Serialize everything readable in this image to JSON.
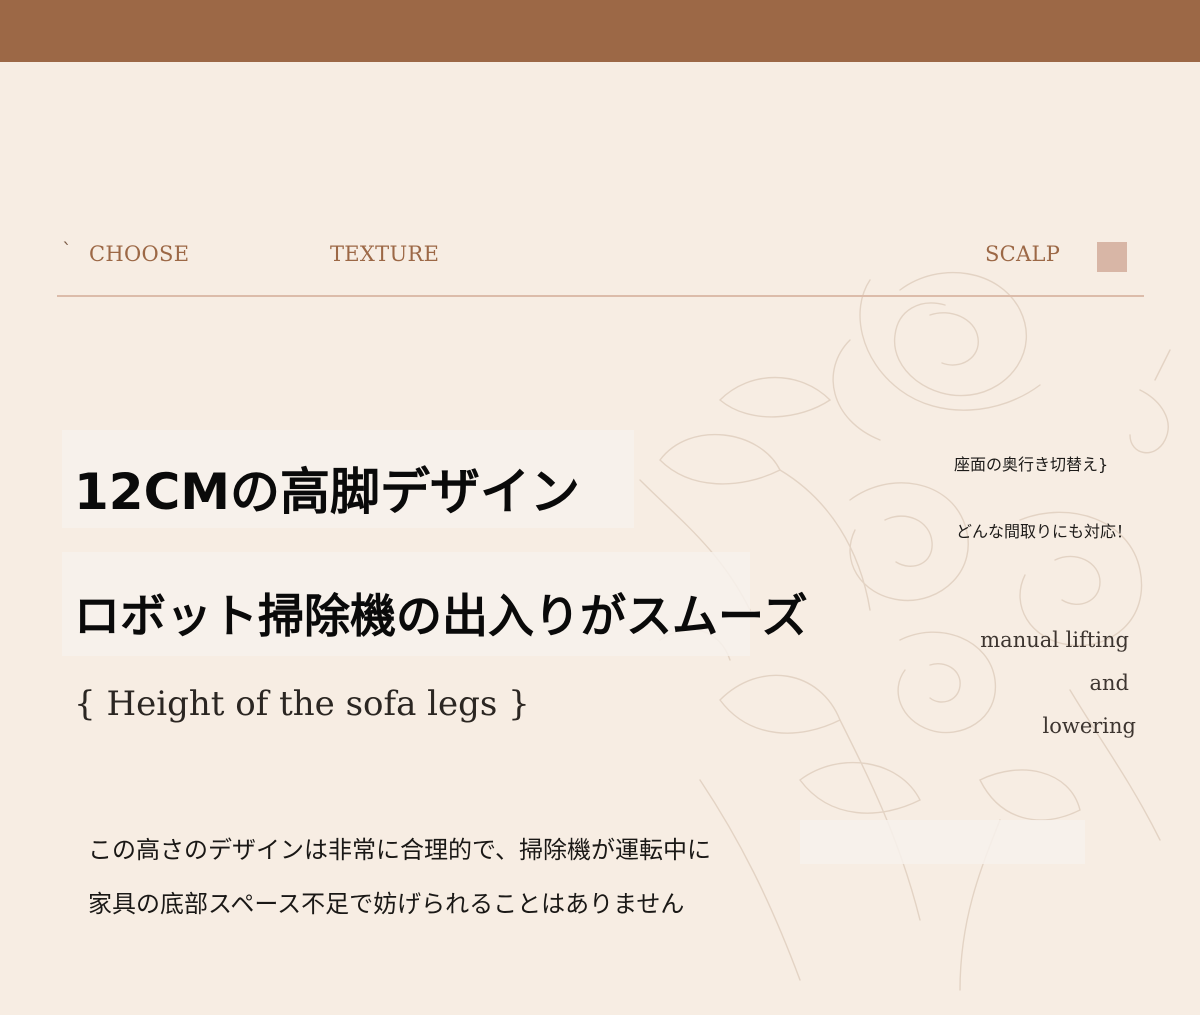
{
  "nav": {
    "tick": "`",
    "items": [
      "CHOOSE",
      "TEXTURE",
      "SCALP"
    ]
  },
  "headline": {
    "line1": "12CMの高脚デザイン",
    "line2": "ロボット掃除機の出入りがスムーズ"
  },
  "subline": "{ Height of the sofa legs }",
  "side_notes": {
    "jp_line1": "座面の奥行き切替え}",
    "jp_line2": "どんな間取りにも対応！",
    "en_lines": [
      "manual lifting",
      "and",
      "lowering"
    ]
  },
  "body": {
    "line1": "この高さのデザインは非常に合理的で、掃除機が運転中に",
    "line2": "家具の底部スペース不足で妨げられることはありません"
  },
  "colors": {
    "top_bar": "#9c6846",
    "background": "#f7ede3",
    "accent_square": "#d8b6a6",
    "nav_text": "#9c6846"
  },
  "decor": {
    "icon": "rose-line-art-icon"
  }
}
